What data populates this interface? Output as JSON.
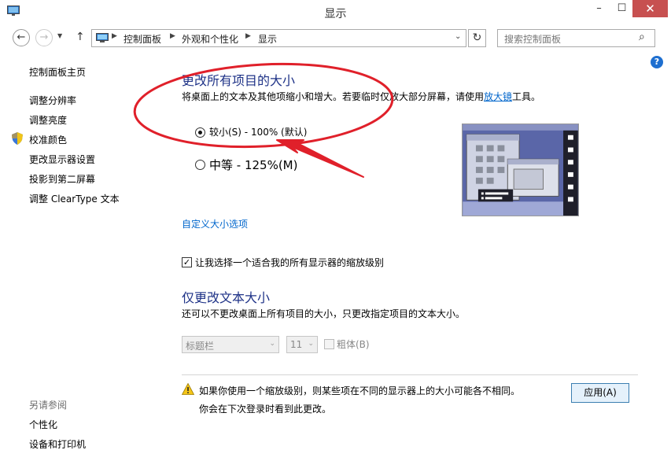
{
  "window": {
    "title": "显示",
    "minimize": "–",
    "maximize": "☐",
    "close": "✕"
  },
  "nav": {
    "back": "←",
    "forward": "→",
    "history": "▼",
    "up": "↑",
    "breadcrumbs": [
      "控制面板",
      "外观和个性化",
      "显示"
    ],
    "separator": "▶",
    "dropdown": "⌄",
    "refresh": "↻",
    "search_placeholder": "搜索控制面板",
    "search_icon": "⌕"
  },
  "help": "?",
  "sidebar": {
    "home": "控制面板主页",
    "items": [
      {
        "label": "调整分辨率"
      },
      {
        "label": "调整亮度"
      },
      {
        "label": "校准颜色"
      },
      {
        "label": "更改显示器设置"
      },
      {
        "label": "投影到第二屏幕"
      },
      {
        "label": "调整 ClearType 文本"
      }
    ],
    "see_also_heading": "另请参阅",
    "see_also": [
      {
        "label": "个性化"
      },
      {
        "label": "设备和打印机"
      }
    ]
  },
  "main": {
    "heading": "更改所有项目的大小",
    "description_before": "将桌面上的文本及其他项缩小和增大。若要临时仅放大部分屏幕，请使用",
    "magnifier_link": "放大镜",
    "description_after": "工具。",
    "options": [
      {
        "label": "较小(S) - 100% (默认)",
        "selected": true
      },
      {
        "label": "中等 - 125%(M)",
        "selected": false
      }
    ],
    "custom_link": "自定义大小选项",
    "scaling_checkbox": {
      "label": "让我选择一个适合我的所有显示器的缩放级别",
      "checked": true,
      "mark": "✓"
    },
    "text_heading": "仅更改文本大小",
    "text_description": "还可以不更改桌面上所有项目的大小，只更改指定项目的文本大小。",
    "element_select": {
      "value": "标题栏",
      "arrow": "⌄"
    },
    "size_select": {
      "value": "11",
      "arrow": "⌄"
    },
    "bold_checkbox": {
      "label": "粗体(B)",
      "checked": false
    },
    "warning_line1": "如果你使用一个缩放级别，则某些项在不同的显示器上的大小可能各不相同。",
    "warning_line2": "你会在下次登录时看到此更改。",
    "apply_button": "应用(A)"
  },
  "colors": {
    "heading": "#1e3287",
    "link": "#0066cc",
    "annotation": "#e0202a",
    "close_button": "#c75050"
  }
}
